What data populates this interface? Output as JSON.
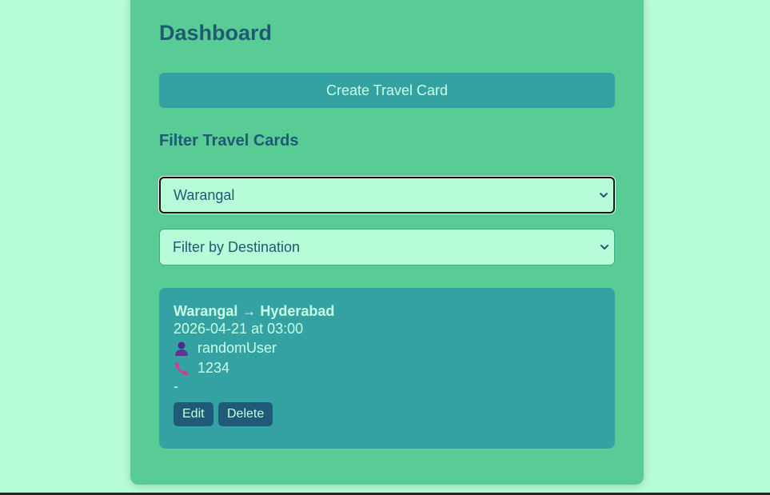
{
  "dashboard": {
    "title": "Dashboard",
    "create_button_label": "Create Travel Card"
  },
  "filters": {
    "heading": "Filter Travel Cards",
    "source_selected": "Warangal",
    "destination_selected": "Filter by Destination"
  },
  "travel_card": {
    "route": "Warangal → Hyderabad",
    "datetime": "2026-04-21 at 03:00",
    "user_icon": "user-icon",
    "username": "randomUser",
    "phone_icon": "phone-icon",
    "phone": "1234",
    "notes": "-",
    "edit_label": "Edit",
    "delete_label": "Delete"
  },
  "colors": {
    "page_background": "#b7fcd8",
    "panel_background": "#59cc96",
    "accent": "#34a2a3",
    "heading_text": "#1e5a72",
    "button_dark": "#1f5a78"
  }
}
